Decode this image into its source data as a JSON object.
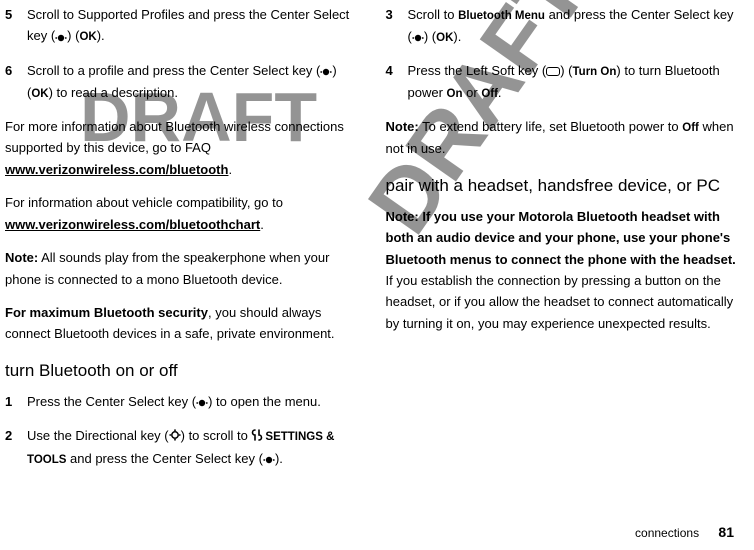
{
  "watermark": "DRAFT",
  "col1": {
    "step5num": "5",
    "step5a": "Scroll to Supported Profiles and press the Center Select key (",
    "step5b": ") (",
    "step5ok": "OK",
    "step5c": ").",
    "step6num": "6",
    "step6a": "Scroll to a profile and press the Center Select key (",
    "step6b": ") (",
    "step6ok": "OK",
    "step6c": ") to read a description.",
    "faq1a": "For more information about Bluetooth wireless connections supported by this device, go to FAQ ",
    "faq1link": "www.verizonwireless.com/bluetooth",
    "faq1b": ".",
    "faq2a": "For information about vehicle compatibility, go to ",
    "faq2link": "www.verizonwireless.com/bluetoothchart",
    "faq2b": ".",
    "noteLabel": "Note:",
    "noteText": " All sounds play from the speakerphone when your phone is connected to a mono Bluetooth device.",
    "secLabel": "For maximum Bluetooth security",
    "secText": ", you should always connect Bluetooth devices in a safe, private environment.",
    "heading": "turn Bluetooth on or off",
    "step1num": "1",
    "step1a": "Press the Center Select key (",
    "step1b": ") to open the menu."
  },
  "col2": {
    "step2num": "2",
    "step2a": "Use the Directional key (",
    "step2b": ") to scroll to ",
    "step2menu": "SETTINGS & TOOLS",
    "step2c": " and press the Center Select key (",
    "step2d": ").",
    "step3num": "3",
    "step3a": "Scroll to ",
    "step3menu": "Bluetooth Menu",
    "step3b": " and press the Center Select key (",
    "step3c": ") (",
    "step3ok": "OK",
    "step3d": ").",
    "step4num": "4",
    "step4a": "Press the Left Soft key (",
    "step4b": ") (",
    "step4turn": "Turn On",
    "step4c": ") to turn Bluetooth power ",
    "step4on": "On",
    "step4or": " or ",
    "step4off": "Off",
    "step4d": ".",
    "note2Label": "Note:",
    "note2a": " To extend battery life, set Bluetooth power to ",
    "note2off": "Off",
    "note2b": " when not in use.",
    "heading2": "pair with a headset, handsfree device, or PC",
    "note3Label": "Note: If you use your Motorola Bluetooth headset with both an audio device and your phone, use your phone's Bluetooth menus to connect the phone with the headset.",
    "note3Text": " If you establish the connection by pressing a button on the headset, or if you allow the headset to connect automatically by turning it on, you may experience unexpected results."
  },
  "footer": {
    "section": "connections",
    "page": "81"
  }
}
